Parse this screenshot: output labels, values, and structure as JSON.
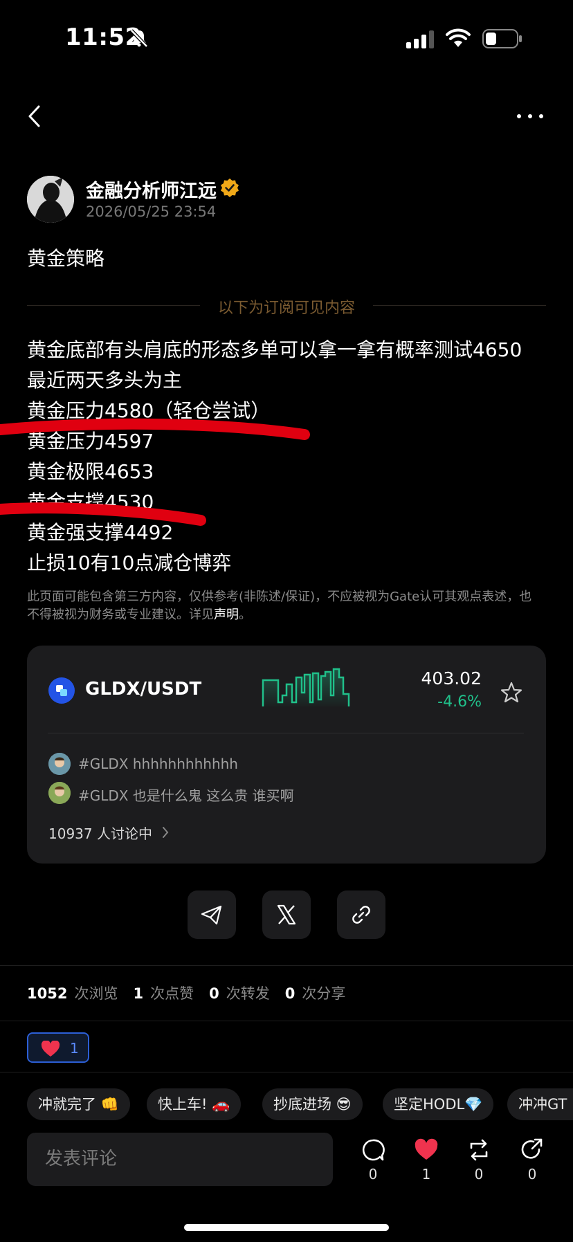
{
  "status_bar": {
    "time": "11:52"
  },
  "author": {
    "name": "金融分析师江远",
    "timestamp": "2026/05/25 23:54"
  },
  "post": {
    "title": "黄金策略",
    "subscriber_divider": "以下为订阅可见内容",
    "lines": [
      "黄金底部有头肩底的形态多单可以拿一拿有概率测试4650",
      "最近两天多头为主",
      "黄金压力4580（轻仓尝试）",
      "黄金压力4597",
      "黄金极限4653",
      "黄金支撑4530",
      "黄金强支撑4492",
      "止损10有10点减仓博弈"
    ],
    "disclaimer": "此页面可能包含第三方内容，仅供参考(非陈述/保证)，不应被视为Gate认可其观点表述，也不得被视为财务或专业建议。详见",
    "disclaimer_link": "声明",
    "disclaimer_end": "。"
  },
  "market_card": {
    "pair": "GLDX/USDT",
    "price": "403.02",
    "change": "-4.6%",
    "colors": {
      "positive": "#20c08a",
      "icon": "#2354e6"
    },
    "comments": [
      {
        "text": "#GLDX hhhhhhhhhhhh"
      },
      {
        "text": "#GLDX 也是什么鬼 这么贵 谁买啊"
      }
    ],
    "discussion": "10937 人讨论中"
  },
  "stats": [
    {
      "num": "1052",
      "label": "次浏览"
    },
    {
      "num": "1",
      "label": "次点赞"
    },
    {
      "num": "0",
      "label": "次转发"
    },
    {
      "num": "0",
      "label": "次分享"
    }
  ],
  "reaction": {
    "count": "1"
  },
  "quick_replies": [
    "冲就完了 👊",
    "快上车! 🚗",
    "抄底进场 😎",
    "坚定HODL💎",
    "冲冲GT"
  ],
  "comment_placeholder": "发表评论",
  "actions": {
    "comments": "0",
    "likes": "1",
    "reposts": "0",
    "shares": "0"
  }
}
